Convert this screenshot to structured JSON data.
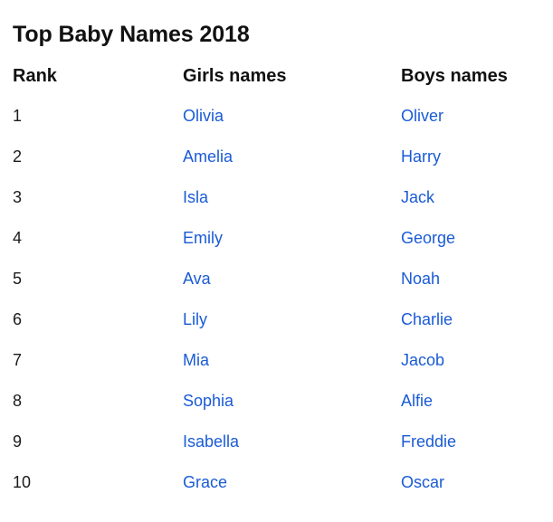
{
  "page": {
    "title": "Top Baby Names 2018",
    "link_color": "#1a5bd6",
    "text_color": "#111111",
    "background_color": "#ffffff"
  },
  "table": {
    "headers": {
      "rank": "Rank",
      "girls": "Girls names",
      "boys": "Boys names"
    },
    "rows": [
      {
        "rank": "1",
        "girl": "Olivia",
        "boy": "Oliver"
      },
      {
        "rank": "2",
        "girl": "Amelia",
        "boy": "Harry"
      },
      {
        "rank": "3",
        "girl": "Isla",
        "boy": "Jack"
      },
      {
        "rank": "4",
        "girl": "Emily",
        "boy": "George"
      },
      {
        "rank": "5",
        "girl": "Ava",
        "boy": "Noah"
      },
      {
        "rank": "6",
        "girl": "Lily",
        "boy": "Charlie"
      },
      {
        "rank": "7",
        "girl": "Mia",
        "boy": "Jacob"
      },
      {
        "rank": "8",
        "girl": "Sophia",
        "boy": "Alfie"
      },
      {
        "rank": "9",
        "girl": "Isabella",
        "boy": "Freddie"
      },
      {
        "rank": "10",
        "girl": "Grace",
        "boy": "Oscar"
      }
    ]
  }
}
